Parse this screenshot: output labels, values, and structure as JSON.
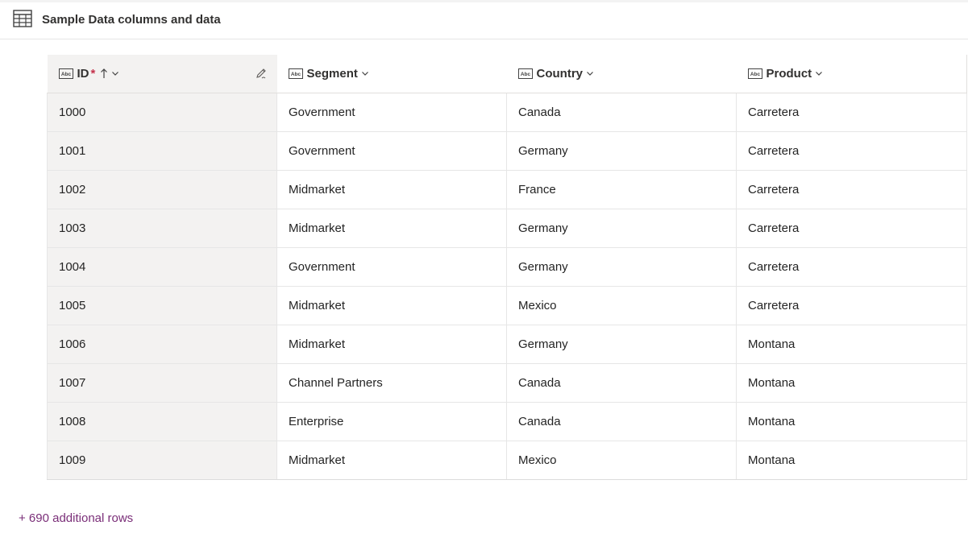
{
  "header": {
    "title": "Sample Data columns and data",
    "icon": "table-icon"
  },
  "columns": [
    {
      "label": "ID",
      "required_marker": "*",
      "icon": "text-type-icon",
      "sorted": "ascending"
    },
    {
      "label": "Segment",
      "icon": "text-type-icon"
    },
    {
      "label": "Country",
      "icon": "text-type-icon"
    },
    {
      "label": "Product",
      "icon": "text-type-icon"
    }
  ],
  "rows": [
    [
      "1000",
      "Government",
      "Canada",
      "Carretera"
    ],
    [
      "1001",
      "Government",
      "Germany",
      "Carretera"
    ],
    [
      "1002",
      "Midmarket",
      "France",
      "Carretera"
    ],
    [
      "1003",
      "Midmarket",
      "Germany",
      "Carretera"
    ],
    [
      "1004",
      "Government",
      "Germany",
      "Carretera"
    ],
    [
      "1005",
      "Midmarket",
      "Mexico",
      "Carretera"
    ],
    [
      "1006",
      "Midmarket",
      "Germany",
      "Montana"
    ],
    [
      "1007",
      "Channel Partners",
      "Canada",
      "Montana"
    ],
    [
      "1008",
      "Enterprise",
      "Canada",
      "Montana"
    ],
    [
      "1009",
      "Midmarket",
      "Mexico",
      "Montana"
    ]
  ],
  "footer": {
    "more_rows_label": "+ 690 additional rows"
  },
  "colors": {
    "link": "#7a2e78",
    "required": "#c4314b",
    "key_column_bg": "#f3f2f1"
  }
}
